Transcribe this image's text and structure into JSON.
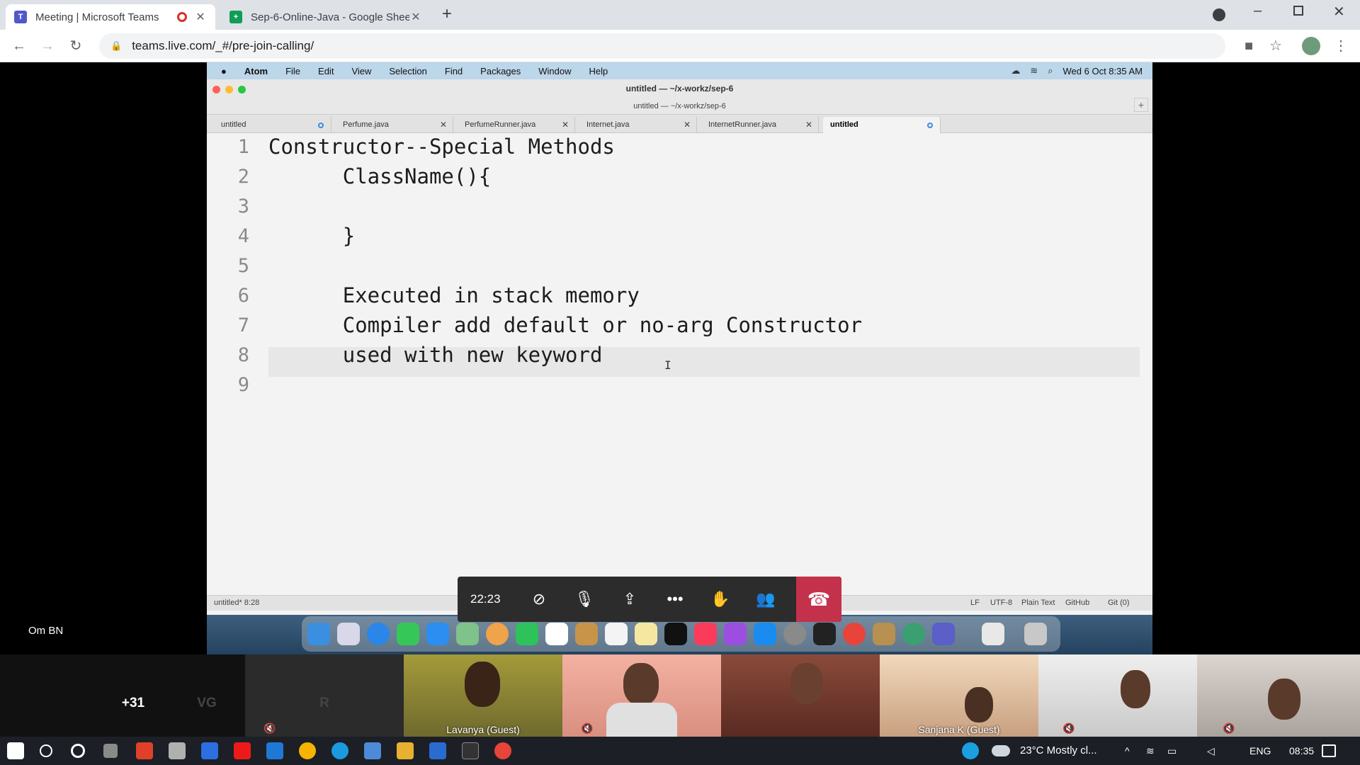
{
  "browser": {
    "tabs": [
      {
        "title": "Meeting | Microsoft Teams",
        "active": true
      },
      {
        "title": "Sep-6-Online-Java - Google Shee",
        "active": false
      }
    ],
    "new_tab": "+",
    "url": "teams.live.com/_#/pre-join-calling/"
  },
  "mac": {
    "menubar": [
      "Atom",
      "File",
      "Edit",
      "View",
      "Selection",
      "Find",
      "Packages",
      "Window",
      "Help"
    ],
    "clock": "Wed 6 Oct  8:35 AM",
    "window_title": "untitled — ~/x-workz/sep-6",
    "window_subtitle": "untitled — ~/x-workz/sep-6"
  },
  "atom": {
    "tabs": [
      {
        "name": "untitled",
        "modified": true
      },
      {
        "name": "Perfume.java",
        "modified": false
      },
      {
        "name": "PerfumeRunner.java",
        "modified": false
      },
      {
        "name": "Internet.java",
        "modified": false
      },
      {
        "name": "InternetRunner.java",
        "modified": false
      },
      {
        "name": "untitled",
        "modified": true,
        "active": true
      }
    ],
    "lines": [
      {
        "n": "1",
        "text": "Constructor--Special Methods"
      },
      {
        "n": "2",
        "text": "      ClassName(){"
      },
      {
        "n": "3",
        "text": ""
      },
      {
        "n": "4",
        "text": "      }"
      },
      {
        "n": "5",
        "text": ""
      },
      {
        "n": "6",
        "text": "      Executed in stack memory"
      },
      {
        "n": "7",
        "text": "      Compiler add default or no-arg Constructor"
      },
      {
        "n": "8",
        "text": "      used with new keyword"
      },
      {
        "n": "9",
        "text": ""
      }
    ],
    "status_left": "untitled*   8:28",
    "status_right": [
      "LF",
      "UTF-8",
      "Plain Text",
      "GitHub",
      "Git (0)"
    ]
  },
  "call": {
    "timer": "22:23",
    "presenter": "Om BN",
    "participants": [
      {
        "label": "+31",
        "color": "#6264a7"
      },
      {
        "label": "VG",
        "color": "#e0dde8"
      },
      {
        "label": "R",
        "color": "#d6dbe0"
      }
    ],
    "video_tiles": [
      "Lavanya (Guest)",
      "",
      "",
      "Sanjana K (Guest)",
      "",
      ""
    ]
  },
  "taskbar": {
    "weather": "23°C  Mostly cl...",
    "lang": "ENG",
    "time": "08:35"
  }
}
